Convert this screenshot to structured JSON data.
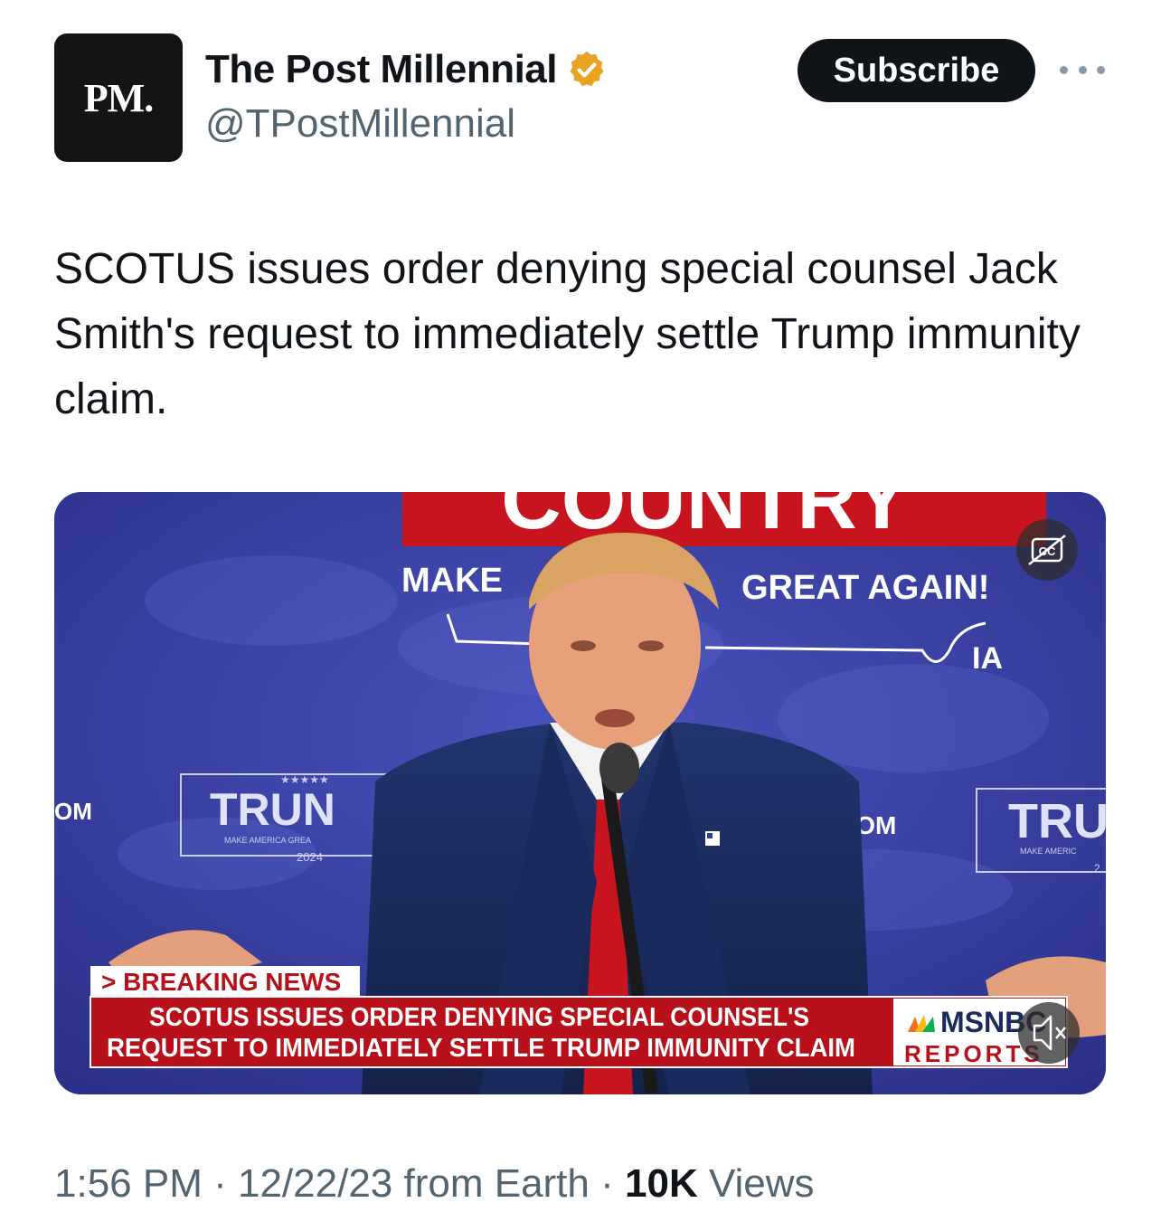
{
  "account": {
    "avatar_text": "PM.",
    "display_name": "The Post Millennial",
    "handle": "@TPostMillennial",
    "verified_badge_icon": "gold-verified-badge-icon",
    "badge_color": "#e8a323"
  },
  "actions": {
    "subscribe_label": "Subscribe",
    "more_icon": "more-dots-icon"
  },
  "tweet": {
    "text": "SCOTUS issues order denying special counsel Jack Smith's request to immediately settle Trump immunity claim."
  },
  "video": {
    "banner_top": "COUNTRY",
    "slogan_left": "MAKE",
    "slogan_right": "GREAT AGAIN!",
    "state_label": "IA",
    "side_left": "OM",
    "side_center": "COM",
    "sign_left_main": "TRUN",
    "sign_left_sub": "MAKE AMERICA GREA",
    "sign_left_year": "2024",
    "sign_left_stars": "★★★★★",
    "sign_right_main": "TRU",
    "sign_right_sub": "MAKE AMERIC",
    "sign_right_year": "2",
    "breaking_label": "> BREAKING NEWS",
    "chyron_line1": "SCOTUS ISSUES ORDER DENYING SPECIAL COUNSEL'S",
    "chyron_line2": "REQUEST TO IMMEDIATELY SETTLE TRUMP IMMUNITY CLAIM",
    "network_name": "MSNBC",
    "network_show": "REPORTS",
    "captions_icon": "closed-captions-off-icon",
    "mute_icon": "speaker-muted-icon",
    "backdrop_color": "#3a42a6",
    "chyron_color": "#b8101a"
  },
  "meta": {
    "time": "1:56 PM",
    "separator": " · ",
    "date": "12/22/23",
    "source": " from Earth",
    "views_count": "10K",
    "views_label": " Views"
  }
}
